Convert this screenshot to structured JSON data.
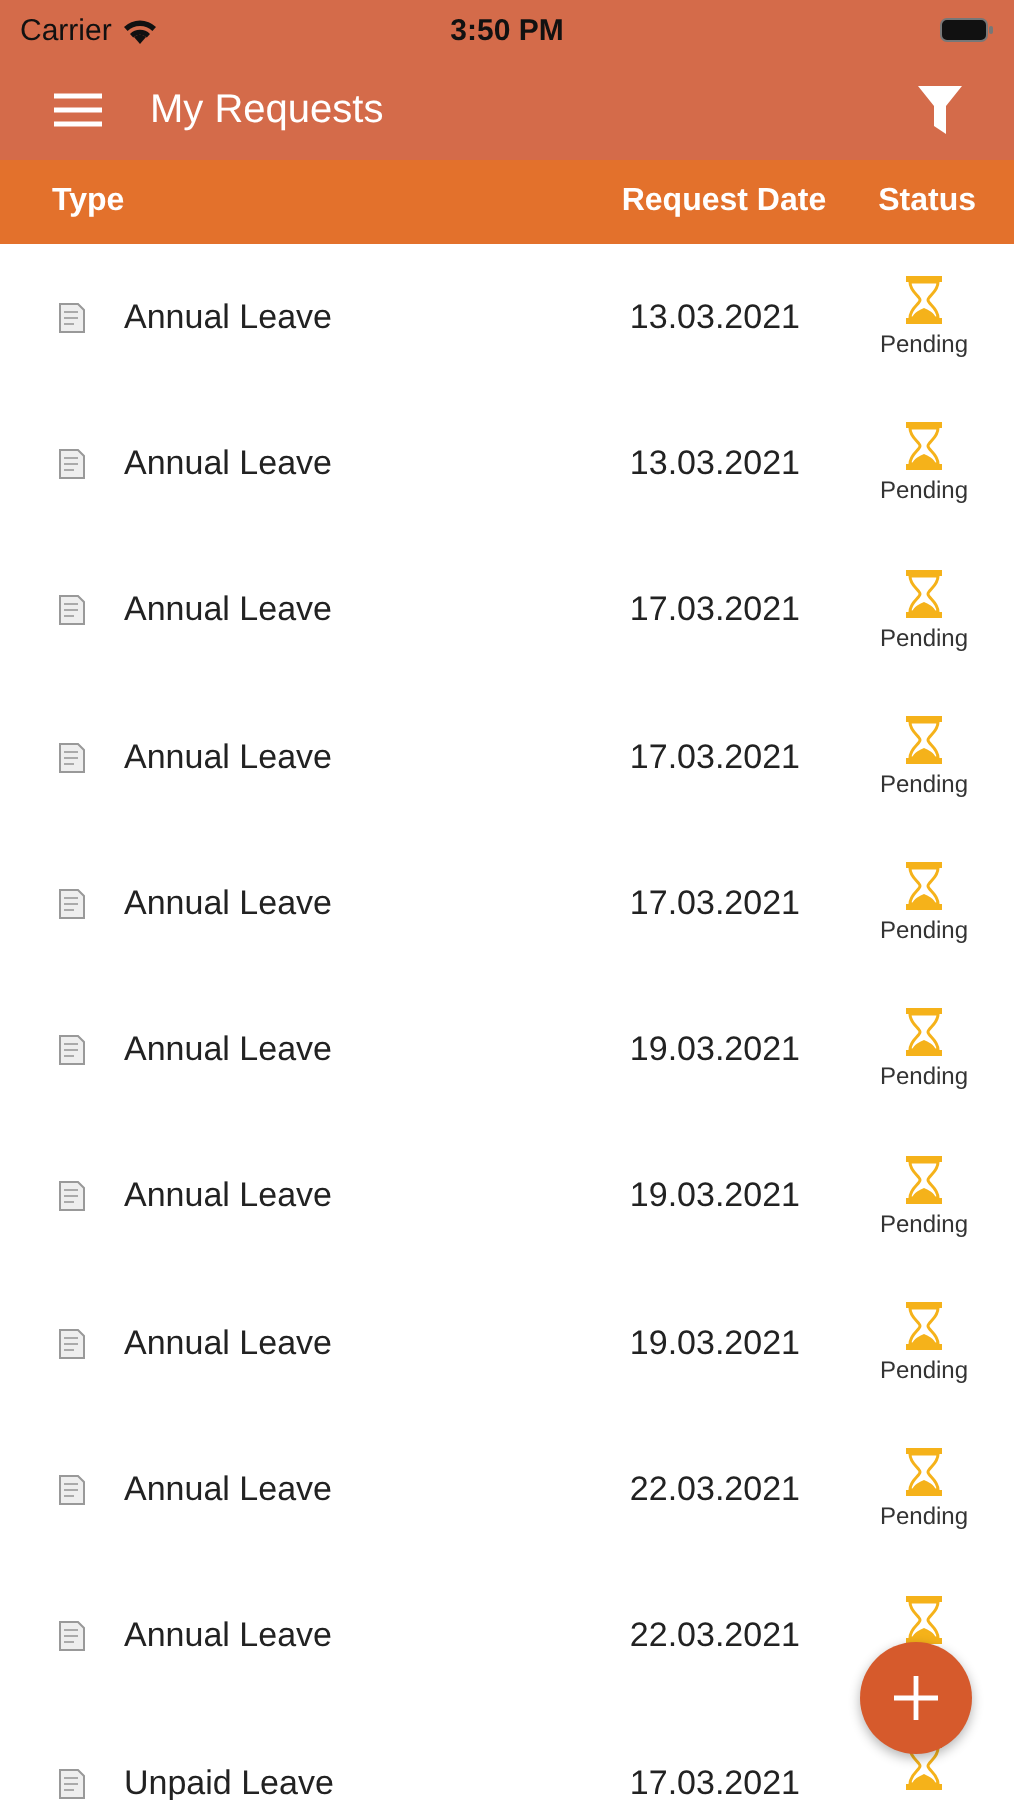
{
  "status_bar": {
    "carrier": "Carrier",
    "time": "3:50 PM"
  },
  "nav": {
    "title": "My Requests"
  },
  "table": {
    "columns": [
      "Type",
      "Request Date",
      "Status"
    ],
    "rows": [
      {
        "type": "Annual Leave",
        "date": "13.03.2021",
        "status": {
          "kind": "pending",
          "label": "Pending"
        }
      },
      {
        "type": "Annual Leave",
        "date": "13.03.2021",
        "status": {
          "kind": "pending",
          "label": "Pending"
        }
      },
      {
        "type": "Annual Leave",
        "date": "17.03.2021",
        "status": {
          "kind": "pending",
          "label": "Pending"
        }
      },
      {
        "type": "Annual Leave",
        "date": "17.03.2021",
        "status": {
          "kind": "pending",
          "label": "Pending"
        }
      },
      {
        "type": "Annual Leave",
        "date": "17.03.2021",
        "status": {
          "kind": "pending",
          "label": "Pending"
        }
      },
      {
        "type": "Annual Leave",
        "date": "19.03.2021",
        "status": {
          "kind": "pending",
          "label": "Pending"
        }
      },
      {
        "type": "Annual Leave",
        "date": "19.03.2021",
        "status": {
          "kind": "pending",
          "label": "Pending"
        }
      },
      {
        "type": "Annual Leave",
        "date": "19.03.2021",
        "status": {
          "kind": "pending",
          "label": "Pending"
        }
      },
      {
        "type": "Annual Leave",
        "date": "22.03.2021",
        "status": {
          "kind": "pending",
          "label": "Pending"
        }
      },
      {
        "type": "Annual Leave",
        "date": "22.03.2021",
        "status": {
          "kind": "pending"
        }
      },
      {
        "type": "Unpaid Leave",
        "date": "17.03.2021",
        "status": {
          "kind": "pending"
        }
      }
    ]
  }
}
